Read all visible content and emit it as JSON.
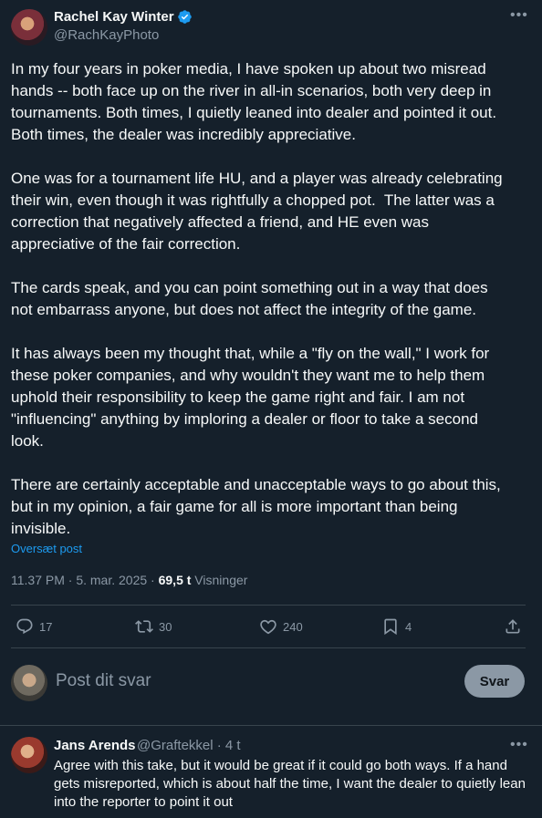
{
  "author": {
    "name": "Rachel Kay Winter",
    "handle": "@RachKayPhoto"
  },
  "tweet": {
    "text": "In my four years in poker media, I have spoken up about two misread\nhands -- both face up on the river in all-in scenarios, both very deep in\ntournaments. Both times, I quietly leaned into dealer and pointed it out.\nBoth times, the dealer was incredibly appreciative.\n\nOne was for a tournament life HU, and a player was already celebrating\ntheir win, even though it was rightfully a chopped pot.  The latter was a\ncorrection that negatively affected a friend, and HE even was\nappreciative of the fair correction.\n\nThe cards speak, and you can point something out in a way that does\nnot embarrass anyone, but does not affect the integrity of the game.\n\nIt has always been my thought that, while a \"fly on the wall,\" I work for\nthese poker companies, and why wouldn't they want me to help them\nuphold their responsibility to keep the game right and fair. I am not\n\"influencing\" anything by imploring a dealer or floor to take a second\nlook.\n\nThere are certainly acceptable and unacceptable ways to go about this,\nbut in my opinion, a fair game for all is more important than being\ninvisible.",
    "translate_label": "Oversæt post",
    "timestamp": "11.37 PM · 5. mar. 2025 · ",
    "views_count": "69,5 t",
    "views_label": " Visninger"
  },
  "actions": {
    "replies": "17",
    "reposts": "30",
    "likes": "240",
    "bookmarks": "4"
  },
  "compose": {
    "placeholder": "Post dit svar",
    "button_label": "Svar"
  },
  "reply": {
    "name": "Jans Arends",
    "handle": "@Graftekkel · 4 t",
    "text": "Agree with this take, but it would be great if it could go both ways. If a hand gets misreported, which is about half the time, I want the dealer to quietly lean into the reporter to point it out"
  },
  "colors": {
    "background": "#15202b",
    "accent": "#1d9bf0",
    "muted": "#8b98a5"
  }
}
